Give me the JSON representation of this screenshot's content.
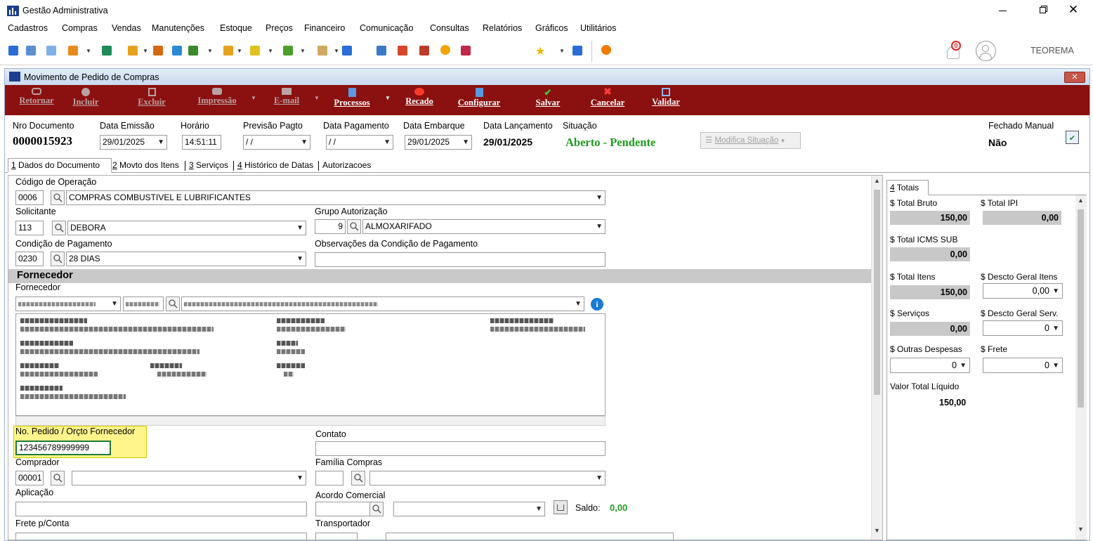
{
  "app": {
    "title": "Gestão Administrativa",
    "user": "TEOREMA",
    "notification_count": "0",
    "menu": [
      "Cadastros",
      "Compras",
      "Vendas",
      "Manutenções",
      "Estoque",
      "Preços",
      "Financeiro",
      "Comunicação",
      "Consultas",
      "Relatórios",
      "Gráficos",
      "Utilitários"
    ]
  },
  "window": {
    "title": "Movimento de Pedido de Compras"
  },
  "ribbon": {
    "retornar": "Retornar",
    "incluir": "Incluir",
    "excluir": "Excluir",
    "impressao": "Impressão",
    "email": "E-mail",
    "processos": "Processos",
    "recado": "Recado",
    "configurar": "Configurar",
    "salvar": "Salvar",
    "cancelar": "Cancelar",
    "validar": "Validar"
  },
  "header": {
    "nro_label": "Nro Documento",
    "nro_value": "0000015923",
    "emissao_label": "Data Emissão",
    "emissao_value": "29/01/2025",
    "horario_label": "Horário",
    "horario_value": "14:51:11",
    "prev_label": "Previsão Pagto",
    "prev_value": "/ /",
    "pag_label": "Data Pagamento",
    "pag_value": "/ /",
    "emb_label": "Data Embarque",
    "emb_value": "29/01/2025",
    "lanc_label": "Data Lançamento",
    "lanc_value": "29/01/2025",
    "sit_label": "Situação",
    "sit_value": "Aberto - Pendente",
    "modifica_label": "Modifica Situação",
    "fechado_label": "Fechado Manual",
    "fechado_value": "Não"
  },
  "tabs": [
    {
      "key": "1",
      "label": " Dados do Documento"
    },
    {
      "key": "2",
      "label": " Movto dos Itens"
    },
    {
      "key": "3",
      "label": " Serviços"
    },
    {
      "key": "4",
      "label": " Histórico de Datas"
    },
    {
      "key": "",
      "label": "Autorizacoes"
    }
  ],
  "form": {
    "codop_label": "Código de Operação",
    "codop_code": "0006",
    "codop_desc": "COMPRAS COMBUSTIVEL E LUBRIFICANTES",
    "solic_label": "Solicitante",
    "solic_code": "113",
    "solic_name": "DEBORA",
    "grupo_label": "Grupo Autorização",
    "grupo_code": "9",
    "grupo_name": "ALMOXARIFADO",
    "cond_label": "Condição de Pagamento",
    "cond_code": "0230",
    "cond_desc": "28 DIAS",
    "obs_label": "Observações da Condição de Pagamento",
    "forn_section": "Fornecedor",
    "forn_label": "Fornecedor",
    "pedido_label": "No. Pedido / Orçto Fornecedor",
    "pedido_value": "123456789999999",
    "contato_label": "Contato",
    "comprador_label": "Comprador",
    "comprador_code": "00001",
    "familia_label": "Família Compras",
    "aplicacao_label": "Aplicação",
    "acordo_label": "Acordo Comercial",
    "saldo_label": "Saldo:",
    "saldo_value": "0,00",
    "frete_conta_label": "Frete p/Conta",
    "transp_label": "Transportador"
  },
  "totals": {
    "tab_key": "4",
    "tab_label": " Totais",
    "bruto_label": "$ Total Bruto",
    "bruto_value": "150,00",
    "ipi_label": "$ Total IPI",
    "ipi_value": "0,00",
    "icms_label": "$ Total ICMS SUB",
    "icms_value": "0,00",
    "itens_label": "$ Total Itens",
    "itens_value": "150,00",
    "desc_itens_label": "$ Descto Geral Itens",
    "desc_itens_value": "0,00",
    "serv_label": "$ Serviços",
    "serv_value": "0,00",
    "desc_serv_label": "$ Descto Geral Serv.",
    "desc_serv_value": "0",
    "outras_label": "$ Outras Despesas",
    "outras_value": "0",
    "frete_label": "$ Frete",
    "frete_value": "0",
    "liquido_label": "Valor Total Líquido",
    "liquido_value": "150,00"
  },
  "colors": {
    "ribbon": "#8b1010",
    "situacao": "#1f9a1f",
    "highlight": "#fff58a",
    "section": "#c9c9c9"
  }
}
